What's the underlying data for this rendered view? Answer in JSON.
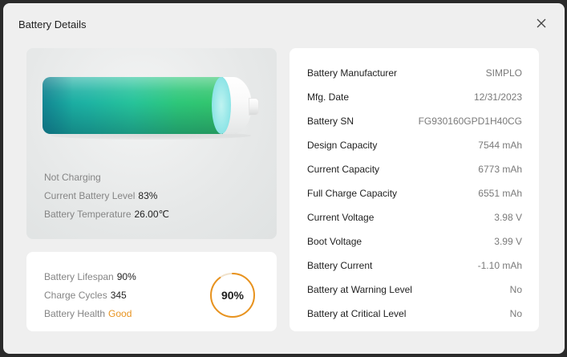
{
  "window": {
    "title": "Battery Details"
  },
  "status": {
    "charging_state": "Not Charging",
    "level_label": "Current Battery Level",
    "level_value": "83%",
    "level_fraction": 0.83,
    "temperature_label": "Battery Temperature",
    "temperature_value": "26.00℃"
  },
  "health": {
    "lifespan_label": "Battery Lifespan",
    "lifespan_value": "90%",
    "cycles_label": "Charge Cycles",
    "cycles_value": "345",
    "health_label": "Battery Health",
    "health_value": "Good",
    "gauge_value": "90%",
    "gauge_fraction": 0.9
  },
  "details": [
    {
      "label": "Battery Manufacturer",
      "value": "SIMPLO"
    },
    {
      "label": "Mfg. Date",
      "value": "12/31/2023"
    },
    {
      "label": "Battery SN",
      "value": "FG930160GPD1H40CG"
    },
    {
      "label": "Design Capacity",
      "value": "7544 mAh"
    },
    {
      "label": "Current Capacity",
      "value": "6773 mAh"
    },
    {
      "label": "Full Charge Capacity",
      "value": "6551 mAh"
    },
    {
      "label": "Current Voltage",
      "value": "3.98 V"
    },
    {
      "label": "Boot Voltage",
      "value": "3.99 V"
    },
    {
      "label": "Battery Current",
      "value": "-1.10 mAh"
    },
    {
      "label": "Battery at Warning Level",
      "value": "No"
    },
    {
      "label": "Battery at Critical Level",
      "value": "No"
    }
  ],
  "colors": {
    "accent_good": "#e8931f",
    "gauge_ring": "#e8931f",
    "battery_fill_start": "#17a3a0",
    "battery_fill_end": "#33c56b"
  },
  "icons": {
    "close": "close-icon"
  }
}
